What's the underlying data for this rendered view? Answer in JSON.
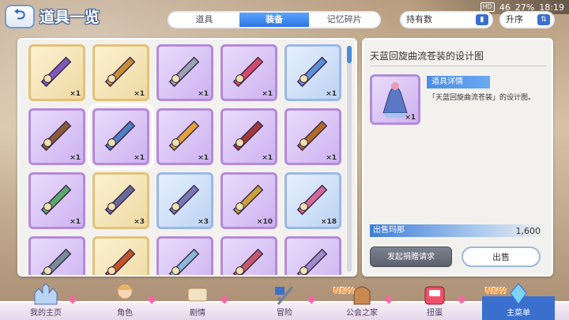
{
  "status_bar": {
    "hd": "HD",
    "signal": "46",
    "battery": "27%",
    "time": "18:19"
  },
  "header": {
    "back_label": "⮌",
    "title": "道具一览"
  },
  "tabs": [
    {
      "label": "道具"
    },
    {
      "label": "装备"
    },
    {
      "label": "记忆碎片"
    }
  ],
  "sort": {
    "filter_label": "持有数",
    "order_label": "升序"
  },
  "grid_items": [
    {
      "name": "claw-equipment",
      "qty": "×1",
      "frame": "gold"
    },
    {
      "name": "bow-equipment",
      "qty": "×1",
      "frame": "gold"
    },
    {
      "name": "sword-equipment",
      "qty": "×1",
      "frame": "purple"
    },
    {
      "name": "katana-equipment",
      "qty": "×1",
      "frame": "purple"
    },
    {
      "name": "blue-blade-equipment",
      "qty": "×1",
      "frame": "blue"
    },
    {
      "name": "staff-design",
      "qty": "×1",
      "frame": "purple"
    },
    {
      "name": "dress-design",
      "qty": "×1",
      "frame": "purple"
    },
    {
      "name": "lantern-design",
      "qty": "×1",
      "frame": "purple"
    },
    {
      "name": "dragon-design",
      "qty": "×1",
      "frame": "purple"
    },
    {
      "name": "bracelet-design",
      "qty": "×1",
      "frame": "purple"
    },
    {
      "name": "earring-equipment",
      "qty": "×1",
      "frame": "purple"
    },
    {
      "name": "chain-equipment",
      "qty": "×3",
      "frame": "gold"
    },
    {
      "name": "greatsword-equipment",
      "qty": "×3",
      "frame": "blue"
    },
    {
      "name": "wand-equipment",
      "qty": "×10",
      "frame": "purple"
    },
    {
      "name": "pendant-equipment",
      "qty": "×18",
      "frame": "blue"
    },
    {
      "name": "armor-design",
      "qty": "",
      "frame": "purple"
    },
    {
      "name": "spear-design",
      "qty": "",
      "frame": "gold"
    },
    {
      "name": "robe-design",
      "qty": "",
      "frame": "purple"
    },
    {
      "name": "outfit-design",
      "qty": "",
      "frame": "purple"
    },
    {
      "name": "shield-design",
      "qty": "",
      "frame": "purple"
    }
  ],
  "detail": {
    "title": "天蓝回旋曲流苍装的设计图",
    "icon_qty": "×1",
    "badge": "道具详情",
    "description": "「天蓝回旋曲流苍装」的设计图。",
    "sale_label": "出售玛那",
    "sale_value": "1,600",
    "gift_button": "发起捐赠请求",
    "sell_button": "出售"
  },
  "nav": [
    {
      "label": "我的主页",
      "new": ""
    },
    {
      "label": "角色",
      "new": ""
    },
    {
      "label": "剧情",
      "new": ""
    },
    {
      "label": "冒险",
      "new": ""
    },
    {
      "label": "公会之家",
      "new": "NEW"
    },
    {
      "label": "扭蛋",
      "new": ""
    },
    {
      "label": "主菜单",
      "new": "NEW"
    }
  ],
  "colors": {
    "accent": "#2f74e0",
    "panel": "#f3f1ee",
    "purple_frame": "#b38bd9",
    "gold_frame": "#e2c27a"
  }
}
